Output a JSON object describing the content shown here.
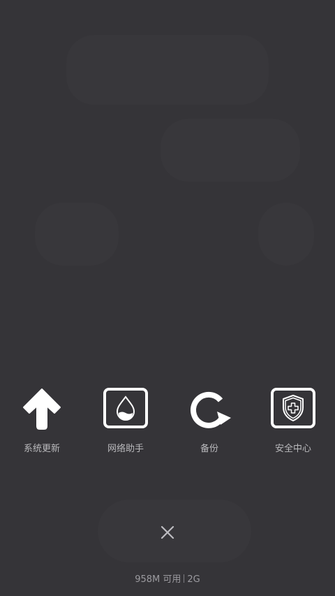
{
  "shortcuts": [
    {
      "label": "系统更新",
      "icon": "arrow-up-icon"
    },
    {
      "label": "网络助手",
      "icon": "droplet-icon"
    },
    {
      "label": "备份",
      "icon": "refresh-icon"
    },
    {
      "label": "安全中心",
      "icon": "shield-plus-icon"
    }
  ],
  "close": {
    "icon": "close-icon"
  },
  "memory": {
    "available": "958M 可用",
    "total": "2G"
  },
  "colors": {
    "background": "#353438",
    "icon": "#ffffff",
    "label": "#b9b9bc",
    "close": "#bdbcc1"
  }
}
